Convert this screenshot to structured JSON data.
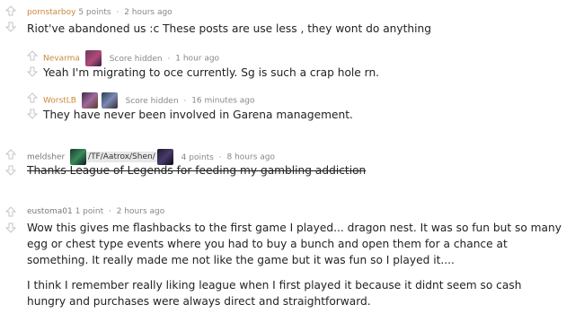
{
  "comments": [
    {
      "author": "pornstarboy",
      "points": "5 points",
      "time": "2 hours ago",
      "body": "Riot've abandoned us :c These posts are use less , they wont do anything"
    },
    {
      "author": "Nevarma",
      "score": "Score hidden",
      "time": "1 hour ago",
      "body": "Yeah I'm migrating to oce currently. Sg is such a crap hole rn."
    },
    {
      "author": "WorstLB",
      "score": "Score hidden",
      "time": "16 minutes ago",
      "body": "They have never been involved in Garena management."
    },
    {
      "author": "meldsher",
      "flair": "/TF/Aatrox/Shen/",
      "points": "4 points",
      "time": "8 hours ago",
      "body": "Thanks League of Legends for feeding my gambling addiction"
    },
    {
      "author": "eustoma01",
      "points": "1 point",
      "time": "2 hours ago",
      "body_p1": "Wow this gives me flashbacks to the first game I played... dragon nest. It was so fun but so many egg or chest type events where you had to buy a bunch and open them for a chance at something. It really made me not like the game but it was fun so I played it....",
      "body_p2": "I think I remember really liking league when I first played it because it didnt seem so cash hungry and purchases were always direct and straightforward."
    }
  ],
  "separator": "·",
  "icons": {
    "upvote": "up-arrow-icon",
    "downvote": "down-arrow-icon"
  },
  "colors": {
    "author": "#c98a3a",
    "meta": "#888888",
    "body": "#222222"
  }
}
